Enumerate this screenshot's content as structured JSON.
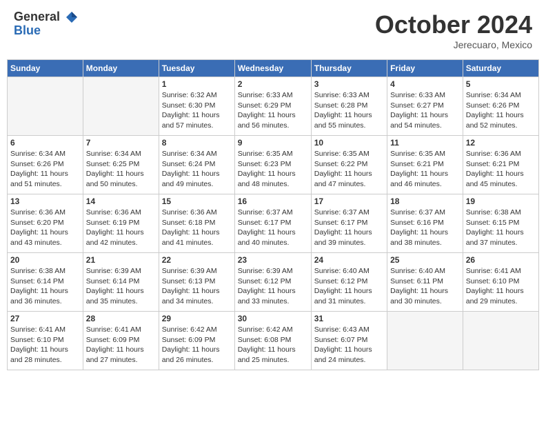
{
  "header": {
    "logo": {
      "line1": "General",
      "line2": "Blue"
    },
    "month": "October 2024",
    "location": "Jerecuaro, Mexico"
  },
  "weekdays": [
    "Sunday",
    "Monday",
    "Tuesday",
    "Wednesday",
    "Thursday",
    "Friday",
    "Saturday"
  ],
  "weeks": [
    [
      {
        "day": "",
        "info": ""
      },
      {
        "day": "",
        "info": ""
      },
      {
        "day": "1",
        "info": "Sunrise: 6:32 AM\nSunset: 6:30 PM\nDaylight: 11 hours and 57 minutes."
      },
      {
        "day": "2",
        "info": "Sunrise: 6:33 AM\nSunset: 6:29 PM\nDaylight: 11 hours and 56 minutes."
      },
      {
        "day": "3",
        "info": "Sunrise: 6:33 AM\nSunset: 6:28 PM\nDaylight: 11 hours and 55 minutes."
      },
      {
        "day": "4",
        "info": "Sunrise: 6:33 AM\nSunset: 6:27 PM\nDaylight: 11 hours and 54 minutes."
      },
      {
        "day": "5",
        "info": "Sunrise: 6:34 AM\nSunset: 6:26 PM\nDaylight: 11 hours and 52 minutes."
      }
    ],
    [
      {
        "day": "6",
        "info": "Sunrise: 6:34 AM\nSunset: 6:26 PM\nDaylight: 11 hours and 51 minutes."
      },
      {
        "day": "7",
        "info": "Sunrise: 6:34 AM\nSunset: 6:25 PM\nDaylight: 11 hours and 50 minutes."
      },
      {
        "day": "8",
        "info": "Sunrise: 6:34 AM\nSunset: 6:24 PM\nDaylight: 11 hours and 49 minutes."
      },
      {
        "day": "9",
        "info": "Sunrise: 6:35 AM\nSunset: 6:23 PM\nDaylight: 11 hours and 48 minutes."
      },
      {
        "day": "10",
        "info": "Sunrise: 6:35 AM\nSunset: 6:22 PM\nDaylight: 11 hours and 47 minutes."
      },
      {
        "day": "11",
        "info": "Sunrise: 6:35 AM\nSunset: 6:21 PM\nDaylight: 11 hours and 46 minutes."
      },
      {
        "day": "12",
        "info": "Sunrise: 6:36 AM\nSunset: 6:21 PM\nDaylight: 11 hours and 45 minutes."
      }
    ],
    [
      {
        "day": "13",
        "info": "Sunrise: 6:36 AM\nSunset: 6:20 PM\nDaylight: 11 hours and 43 minutes."
      },
      {
        "day": "14",
        "info": "Sunrise: 6:36 AM\nSunset: 6:19 PM\nDaylight: 11 hours and 42 minutes."
      },
      {
        "day": "15",
        "info": "Sunrise: 6:36 AM\nSunset: 6:18 PM\nDaylight: 11 hours and 41 minutes."
      },
      {
        "day": "16",
        "info": "Sunrise: 6:37 AM\nSunset: 6:17 PM\nDaylight: 11 hours and 40 minutes."
      },
      {
        "day": "17",
        "info": "Sunrise: 6:37 AM\nSunset: 6:17 PM\nDaylight: 11 hours and 39 minutes."
      },
      {
        "day": "18",
        "info": "Sunrise: 6:37 AM\nSunset: 6:16 PM\nDaylight: 11 hours and 38 minutes."
      },
      {
        "day": "19",
        "info": "Sunrise: 6:38 AM\nSunset: 6:15 PM\nDaylight: 11 hours and 37 minutes."
      }
    ],
    [
      {
        "day": "20",
        "info": "Sunrise: 6:38 AM\nSunset: 6:14 PM\nDaylight: 11 hours and 36 minutes."
      },
      {
        "day": "21",
        "info": "Sunrise: 6:39 AM\nSunset: 6:14 PM\nDaylight: 11 hours and 35 minutes."
      },
      {
        "day": "22",
        "info": "Sunrise: 6:39 AM\nSunset: 6:13 PM\nDaylight: 11 hours and 34 minutes."
      },
      {
        "day": "23",
        "info": "Sunrise: 6:39 AM\nSunset: 6:12 PM\nDaylight: 11 hours and 33 minutes."
      },
      {
        "day": "24",
        "info": "Sunrise: 6:40 AM\nSunset: 6:12 PM\nDaylight: 11 hours and 31 minutes."
      },
      {
        "day": "25",
        "info": "Sunrise: 6:40 AM\nSunset: 6:11 PM\nDaylight: 11 hours and 30 minutes."
      },
      {
        "day": "26",
        "info": "Sunrise: 6:41 AM\nSunset: 6:10 PM\nDaylight: 11 hours and 29 minutes."
      }
    ],
    [
      {
        "day": "27",
        "info": "Sunrise: 6:41 AM\nSunset: 6:10 PM\nDaylight: 11 hours and 28 minutes."
      },
      {
        "day": "28",
        "info": "Sunrise: 6:41 AM\nSunset: 6:09 PM\nDaylight: 11 hours and 27 minutes."
      },
      {
        "day": "29",
        "info": "Sunrise: 6:42 AM\nSunset: 6:09 PM\nDaylight: 11 hours and 26 minutes."
      },
      {
        "day": "30",
        "info": "Sunrise: 6:42 AM\nSunset: 6:08 PM\nDaylight: 11 hours and 25 minutes."
      },
      {
        "day": "31",
        "info": "Sunrise: 6:43 AM\nSunset: 6:07 PM\nDaylight: 11 hours and 24 minutes."
      },
      {
        "day": "",
        "info": ""
      },
      {
        "day": "",
        "info": ""
      }
    ]
  ]
}
